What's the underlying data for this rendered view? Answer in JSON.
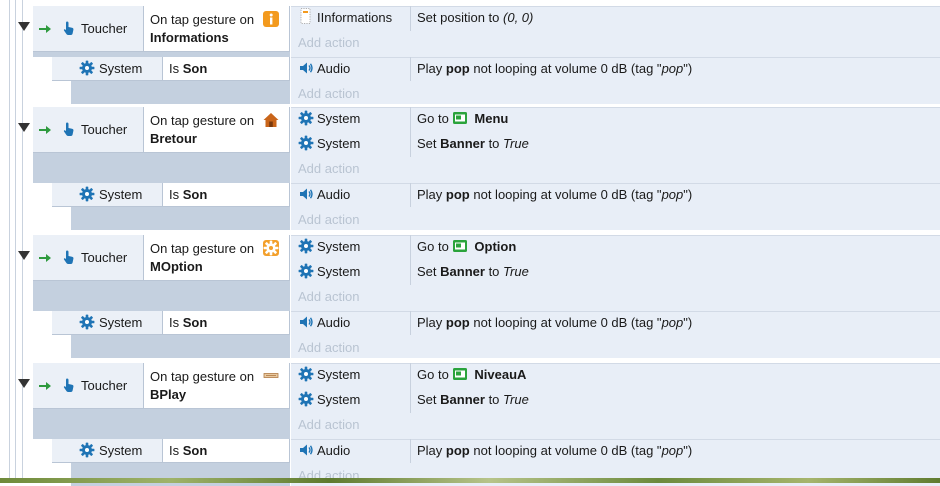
{
  "labels": {
    "add_action": "Add action",
    "on_tap_prefix": "On tap gesture on",
    "toucher": "Toucher",
    "system": "System",
    "audio": "Audio",
    "is_label": "Is",
    "son": "Son",
    "go_to": "Go to",
    "set": "Set",
    "banner": "Banner",
    "to": "to",
    "true_val": "True",
    "play": "Play",
    "pop": "pop",
    "play_rest": "not looping at volume 0 dB (tag \"",
    "close_quote": "\")",
    "informations_obj": "IInformations",
    "set_position_to": "Set position to",
    "position_value": "(0, 0)"
  },
  "events": [
    {
      "object": "Informations",
      "icon": "info-icon",
      "actions": [
        {
          "kind": "position"
        }
      ]
    },
    {
      "object": "Bretour",
      "icon": "house-icon",
      "actions": [
        {
          "kind": "goto",
          "scene": "Menu"
        },
        {
          "kind": "banner"
        }
      ]
    },
    {
      "object": "MOption",
      "icon": "gear-orange-icon",
      "actions": [
        {
          "kind": "goto",
          "scene": "Option"
        },
        {
          "kind": "banner"
        }
      ]
    },
    {
      "object": "BPlay",
      "icon": "sprite-icon",
      "actions": [
        {
          "kind": "goto",
          "scene": "NiveauA"
        },
        {
          "kind": "banner"
        }
      ]
    }
  ],
  "colors": {
    "condition_panel": "#c4d0df",
    "action_panel": "#e8eef7",
    "arrow": "#2e9a3e",
    "touch_icon": "#1f74b5",
    "gear": "#1f74b5",
    "scene_icon": "#2aa33c"
  }
}
